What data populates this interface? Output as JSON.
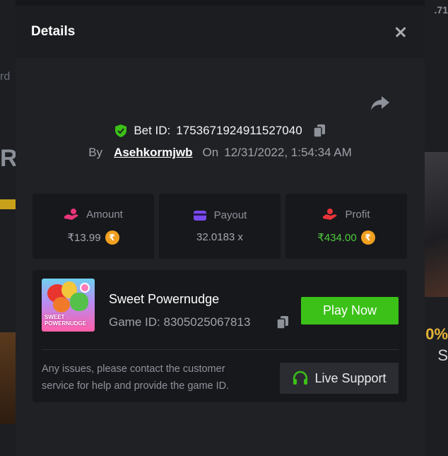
{
  "modal": {
    "title": "Details",
    "bet_id_label": "Bet ID:",
    "bet_id": "1753671924911527040",
    "by_label": "By",
    "username": "Asehkormjwb",
    "on_label": "On",
    "datetime": "12/31/2022, 1:54:34 AM"
  },
  "stats": {
    "amount_label": "Amount",
    "amount_value": "₹13.99",
    "payout_label": "Payout",
    "payout_value": "32.0183 x",
    "profit_label": "Profit",
    "profit_value": "₹434.00",
    "coin_symbol": "₹"
  },
  "game": {
    "name": "Sweet Powernudge",
    "id_label": "Game ID:",
    "id": "8305025067813",
    "thumb_text": "SWEET POWERNUDGE",
    "play_label": "Play Now"
  },
  "support": {
    "message": "Any issues, please contact the customer service for help and provide the game ID.",
    "button_label": "Live Support"
  },
  "background": {
    "left_fragment_1": "rd",
    "left_fragment_2": "R(",
    "right_fragment_top": ".71",
    "right_fragment_pct": "0%",
    "right_fragment_s": "S"
  },
  "colors": {
    "accent_green": "#3bc117",
    "profit_green": "#4fcb3c",
    "coin_orange": "#f0a020"
  },
  "icons": {
    "close": "close-icon",
    "share": "share-icon",
    "verified": "shield-check-icon",
    "copy": "copy-icon",
    "amount": "hand-coin-icon",
    "payout": "card-icon",
    "profit": "hand-person-icon",
    "support": "headset-icon"
  }
}
